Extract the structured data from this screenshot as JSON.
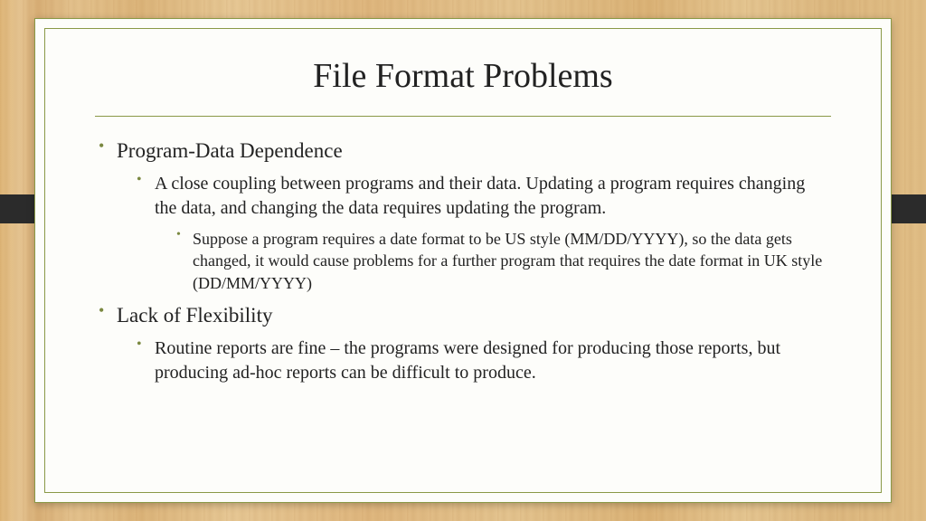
{
  "slide": {
    "title": "File Format Problems",
    "bullets": [
      {
        "text": "Program-Data Dependence",
        "children": [
          {
            "text": "A close coupling between programs and their data.  Updating a program requires changing the data, and changing the data requires updating the program.",
            "children": [
              {
                "text": "Suppose a program requires a date format to be US style (MM/DD/YYYY), so the data gets changed, it would cause problems for a further program that requires the date format in UK style (DD/MM/YYYY)"
              }
            ]
          }
        ]
      },
      {
        "text": "Lack of Flexibility",
        "children": [
          {
            "text": "Routine reports are fine – the programs were designed for producing those reports, but producing ad-hoc reports can be difficult to produce."
          }
        ]
      }
    ]
  }
}
